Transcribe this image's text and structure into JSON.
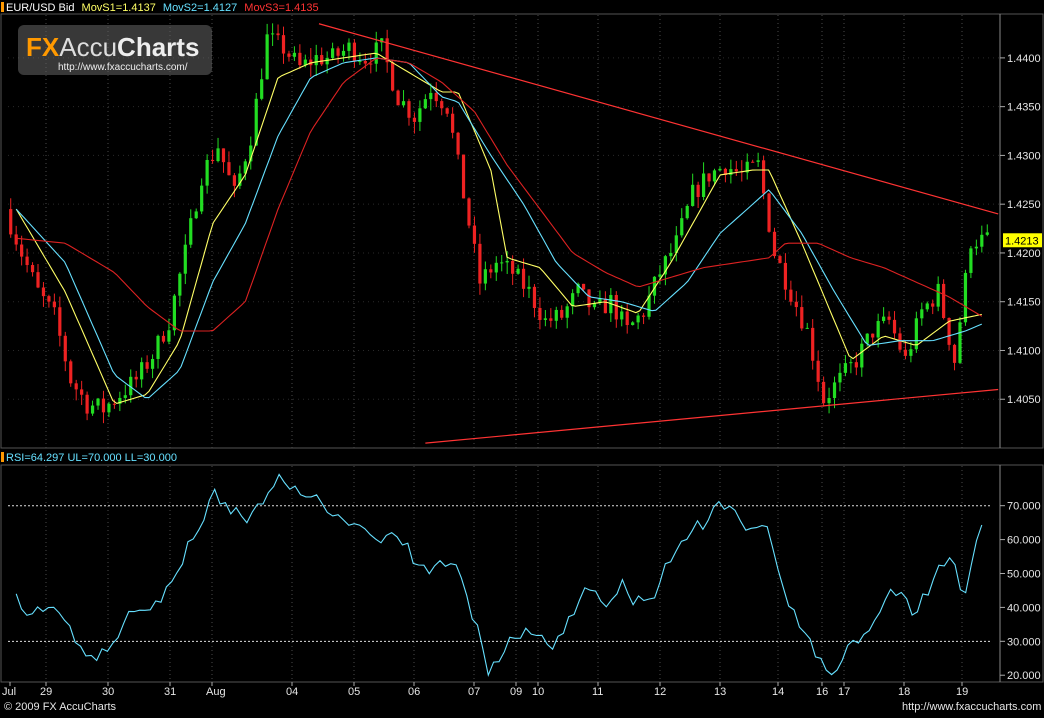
{
  "header": {
    "symbol_label": "EUR/USD Bid",
    "ma1_label": "MovS1=1.4137",
    "ma2_label": "MovS2=1.4127",
    "ma3_label": "MovS3=1.4135",
    "indicator_label": "RSI=64.297 UL=70.000 LL=30.000"
  },
  "branding": {
    "logo_fx": "FX",
    "logo_accu": "Accu",
    "logo_charts": "Charts",
    "logo_url": "http://www.fxaccucharts.com/"
  },
  "footer": {
    "copyright": "© 2009 FX AccuCharts",
    "website": "http://www.fxaccucharts.com"
  },
  "colors": {
    "background": "#000000",
    "up_candle": "#22dd22",
    "down_candle": "#ee2222",
    "ma1": "#ffff66",
    "ma2": "#66e0ff",
    "ma3": "#dd2222",
    "trendline": "#ff3333",
    "rsi": "#66e0ff",
    "last_price_tag": "#ffff00",
    "grid": "#4a4a4a"
  },
  "chart_data": [
    {
      "type": "candlestick",
      "instrument": "EUR/USD Bid",
      "ylim": [
        1.4,
        1.4445
      ],
      "yticks": [
        1.405,
        1.41,
        1.415,
        1.42,
        1.425,
        1.43,
        1.435,
        1.44
      ],
      "ytick_labels": [
        "1.4050",
        "1.4100",
        "1.4150",
        "1.4200",
        "1.4250",
        "1.4300",
        "1.4350",
        "1.4400"
      ],
      "last_price": 1.4213,
      "last_price_label": "1.4213",
      "x_labels": [
        "Jul",
        "29",
        "30",
        "31",
        "Aug",
        "04",
        "05",
        "06",
        "07",
        "09",
        "10",
        "11",
        "12",
        "13",
        "14",
        "16",
        "17",
        "18",
        "19"
      ],
      "close_path_anchors": [
        [
          0,
          1.4245
        ],
        [
          1,
          1.42
        ],
        [
          2,
          1.416
        ],
        [
          3,
          1.4135
        ],
        [
          4,
          1.407
        ],
        [
          5,
          1.4045
        ],
        [
          6,
          1.404
        ],
        [
          7,
          1.4055
        ],
        [
          8,
          1.407
        ],
        [
          9,
          1.4095
        ],
        [
          10,
          1.413
        ],
        [
          11,
          1.42
        ],
        [
          12,
          1.428
        ],
        [
          13,
          1.431
        ],
        [
          14,
          1.426
        ],
        [
          15,
          1.432
        ],
        [
          16,
          1.442
        ],
        [
          17,
          1.441
        ],
        [
          18,
          1.439
        ],
        [
          19,
          1.44
        ],
        [
          20,
          1.44
        ],
        [
          21,
          1.441
        ],
        [
          22,
          1.44
        ],
        [
          23,
          1.441
        ],
        [
          24,
          1.436
        ],
        [
          25,
          1.434
        ],
        [
          26,
          1.437
        ],
        [
          27,
          1.435
        ],
        [
          28,
          1.426
        ],
        [
          29,
          1.417
        ],
        [
          30,
          1.419
        ],
        [
          31,
          1.418
        ],
        [
          32,
          1.416
        ],
        [
          33,
          1.413
        ],
        [
          34,
          1.4135
        ],
        [
          35,
          1.416
        ],
        [
          36,
          1.414
        ],
        [
          37,
          1.415
        ],
        [
          38,
          1.412
        ],
        [
          39,
          1.414
        ],
        [
          40,
          1.418
        ],
        [
          41,
          1.421
        ],
        [
          42,
          1.426
        ],
        [
          43,
          1.428
        ],
        [
          44,
          1.429
        ],
        [
          45,
          1.428
        ],
        [
          46,
          1.429
        ],
        [
          47,
          1.42
        ],
        [
          48,
          1.416
        ],
        [
          49,
          1.412
        ],
        [
          50,
          1.405
        ],
        [
          51,
          1.407
        ],
        [
          52,
          1.409
        ],
        [
          53,
          1.412
        ],
        [
          54,
          1.413
        ],
        [
          55,
          1.409
        ],
        [
          56,
          1.414
        ],
        [
          57,
          1.416
        ],
        [
          58,
          1.409
        ],
        [
          59,
          1.4213
        ]
      ],
      "series": [
        {
          "name": "MovS1",
          "value": 1.4137,
          "anchors": [
            [
              0,
              1.4245
            ],
            [
              3,
              1.416
            ],
            [
              6,
              1.4045
            ],
            [
              8,
              1.4055
            ],
            [
              10,
              1.411
            ],
            [
              12,
              1.423
            ],
            [
              14,
              1.428
            ],
            [
              16,
              1.438
            ],
            [
              18,
              1.4395
            ],
            [
              20,
              1.44
            ],
            [
              22,
              1.4405
            ],
            [
              24,
              1.4385
            ],
            [
              26,
              1.4365
            ],
            [
              27,
              1.4365
            ],
            [
              29,
              1.4285
            ],
            [
              30,
              1.4195
            ],
            [
              32,
              1.4185
            ],
            [
              34,
              1.4145
            ],
            [
              36,
              1.415
            ],
            [
              38,
              1.4138
            ],
            [
              40,
              1.419
            ],
            [
              42,
              1.425
            ],
            [
              43,
              1.428
            ],
            [
              45,
              1.4285
            ],
            [
              46,
              1.4285
            ],
            [
              48,
              1.421
            ],
            [
              50,
              1.413
            ],
            [
              51,
              1.409
            ],
            [
              53,
              1.4115
            ],
            [
              55,
              1.4105
            ],
            [
              57,
              1.413
            ],
            [
              59,
              1.4137
            ]
          ]
        },
        {
          "name": "MovS2",
          "value": 1.4127,
          "anchors": [
            [
              0,
              1.4245
            ],
            [
              3,
              1.419
            ],
            [
              6,
              1.4075
            ],
            [
              8,
              1.405
            ],
            [
              10,
              1.408
            ],
            [
              12,
              1.417
            ],
            [
              14,
              1.423
            ],
            [
              16,
              1.432
            ],
            [
              18,
              1.438
            ],
            [
              20,
              1.4395
            ],
            [
              22,
              1.44
            ],
            [
              24,
              1.4395
            ],
            [
              26,
              1.436
            ],
            [
              27,
              1.4355
            ],
            [
              29,
              1.43
            ],
            [
              31,
              1.425
            ],
            [
              33,
              1.419
            ],
            [
              35,
              1.4155
            ],
            [
              37,
              1.415
            ],
            [
              39,
              1.414
            ],
            [
              41,
              1.417
            ],
            [
              43,
              1.422
            ],
            [
              45,
              1.425
            ],
            [
              46,
              1.4265
            ],
            [
              48,
              1.422
            ],
            [
              50,
              1.416
            ],
            [
              52,
              1.4105
            ],
            [
              54,
              1.411
            ],
            [
              56,
              1.411
            ],
            [
              58,
              1.412
            ],
            [
              59,
              1.4127
            ]
          ]
        },
        {
          "name": "MovS3",
          "value": 1.4135,
          "anchors": [
            [
              0,
              1.4215
            ],
            [
              3,
              1.421
            ],
            [
              6,
              1.418
            ],
            [
              8,
              1.4145
            ],
            [
              10,
              1.412
            ],
            [
              12,
              1.412
            ],
            [
              14,
              1.415
            ],
            [
              16,
              1.4245
            ],
            [
              18,
              1.4325
            ],
            [
              20,
              1.4375
            ],
            [
              22,
              1.44
            ],
            [
              24,
              1.4395
            ],
            [
              26,
              1.4375
            ],
            [
              28,
              1.4345
            ],
            [
              30,
              1.429
            ],
            [
              32,
              1.4245
            ],
            [
              34,
              1.42
            ],
            [
              36,
              1.418
            ],
            [
              38,
              1.4165
            ],
            [
              40,
              1.4175
            ],
            [
              42,
              1.4185
            ],
            [
              44,
              1.419
            ],
            [
              46,
              1.4195
            ],
            [
              47,
              1.421
            ],
            [
              49,
              1.421
            ],
            [
              51,
              1.4195
            ],
            [
              53,
              1.4185
            ],
            [
              55,
              1.417
            ],
            [
              57,
              1.4155
            ],
            [
              59,
              1.4135
            ]
          ]
        }
      ],
      "trendlines": [
        {
          "from": [
            18.5,
            1.4435
          ],
          "to": [
            60,
            1.424
          ]
        },
        {
          "from": [
            25,
            1.4005
          ],
          "to": [
            60,
            1.406
          ]
        }
      ]
    },
    {
      "type": "line",
      "indicator": "RSI",
      "value": 64.297,
      "upper_limit": 70,
      "lower_limit": 30,
      "ylim": [
        18,
        82
      ],
      "yticks": [
        20,
        30,
        40,
        50,
        60,
        70
      ],
      "ytick_labels": [
        "20.000",
        "30.000",
        "40.000",
        "50.000",
        "60.000",
        "70.000"
      ],
      "values_anchors": [
        [
          0,
          44
        ],
        [
          1,
          38
        ],
        [
          2,
          40
        ],
        [
          3,
          36
        ],
        [
          4,
          28
        ],
        [
          5,
          24
        ],
        [
          6,
          30
        ],
        [
          7,
          40
        ],
        [
          8,
          39
        ],
        [
          9,
          42
        ],
        [
          10,
          52
        ],
        [
          11,
          62
        ],
        [
          12,
          74
        ],
        [
          13,
          70
        ],
        [
          14,
          66
        ],
        [
          15,
          72
        ],
        [
          16,
          77
        ],
        [
          17,
          74
        ],
        [
          18,
          72
        ],
        [
          19,
          70
        ],
        [
          20,
          66
        ],
        [
          21,
          64
        ],
        [
          22,
          60
        ],
        [
          23,
          62
        ],
        [
          24,
          56
        ],
        [
          25,
          50
        ],
        [
          26,
          54
        ],
        [
          27,
          52
        ],
        [
          28,
          36
        ],
        [
          29,
          20
        ],
        [
          30,
          28
        ],
        [
          31,
          34
        ],
        [
          32,
          30
        ],
        [
          33,
          28
        ],
        [
          34,
          38
        ],
        [
          35,
          48
        ],
        [
          36,
          40
        ],
        [
          37,
          46
        ],
        [
          38,
          41
        ],
        [
          39,
          44
        ],
        [
          40,
          54
        ],
        [
          41,
          62
        ],
        [
          42,
          64
        ],
        [
          43,
          70
        ],
        [
          44,
          66
        ],
        [
          45,
          64
        ],
        [
          46,
          62
        ],
        [
          47,
          42
        ],
        [
          48,
          34
        ],
        [
          49,
          26
        ],
        [
          50,
          20
        ],
        [
          51,
          30
        ],
        [
          52,
          32
        ],
        [
          53,
          42
        ],
        [
          54,
          45
        ],
        [
          55,
          38
        ],
        [
          56,
          48
        ],
        [
          57,
          55
        ],
        [
          58,
          44
        ],
        [
          59,
          64.297
        ]
      ]
    }
  ]
}
